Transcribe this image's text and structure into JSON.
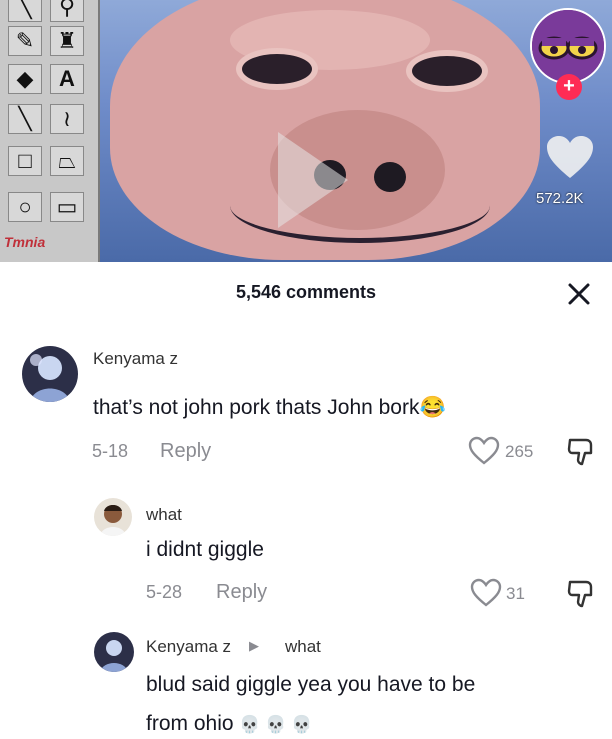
{
  "video": {
    "like_count": "572.2K",
    "toolbox_label": "Tmnia"
  },
  "comments_header": {
    "count_label": "5,546 comments"
  },
  "comments": [
    {
      "username": "Kenyama z",
      "text": "that’s not john pork thats John bork",
      "emoji": "😂",
      "date": "5-18",
      "reply_label": "Reply",
      "likes": "265"
    },
    {
      "username": "what",
      "text": "i didnt giggle",
      "date": "5-28",
      "reply_label": "Reply",
      "likes": "31"
    },
    {
      "username": "Kenyama z",
      "reply_to": "what",
      "text_line1": "blud said giggle yea you have to be",
      "text_line2": "from ohio",
      "emoji": "💀 💀 💀"
    }
  ],
  "colors": {
    "accent": "#fe2c55",
    "meta_gray": "#8a8b91"
  }
}
